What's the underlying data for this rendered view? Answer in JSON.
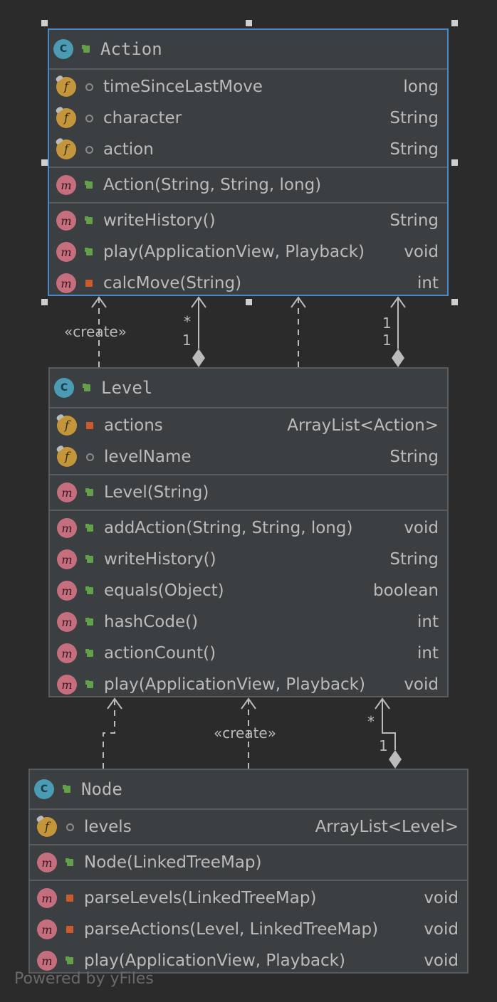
{
  "classes": {
    "action": {
      "name": "Action",
      "fields": [
        {
          "badge": "f",
          "vis": "package",
          "name": "timeSinceLastMove",
          "type": "long"
        },
        {
          "badge": "f",
          "vis": "package",
          "name": "character",
          "type": "String"
        },
        {
          "badge": "f",
          "vis": "package",
          "name": "action",
          "type": "String"
        }
      ],
      "constructors": [
        {
          "badge": "m",
          "vis": "public",
          "name": "Action(String, String, long)",
          "type": ""
        }
      ],
      "methods": [
        {
          "badge": "m",
          "vis": "public",
          "name": "writeHistory()",
          "type": "String"
        },
        {
          "badge": "m",
          "vis": "public",
          "name": "play(ApplicationView, Playback)",
          "type": "void"
        },
        {
          "badge": "m",
          "vis": "private",
          "name": "calcMove(String)",
          "type": "int"
        }
      ]
    },
    "level": {
      "name": "Level",
      "fields": [
        {
          "badge": "f",
          "vis": "private",
          "name": "actions",
          "type": "ArrayList<Action>"
        },
        {
          "badge": "f",
          "vis": "package",
          "name": "levelName",
          "type": "String"
        }
      ],
      "constructors": [
        {
          "badge": "m",
          "vis": "public",
          "name": "Level(String)",
          "type": ""
        }
      ],
      "methods": [
        {
          "badge": "m",
          "vis": "public",
          "name": "addAction(String, String, long)",
          "type": "void"
        },
        {
          "badge": "m",
          "vis": "public",
          "name": "writeHistory()",
          "type": "String"
        },
        {
          "badge": "m",
          "vis": "public",
          "name": "equals(Object)",
          "type": "boolean"
        },
        {
          "badge": "m",
          "vis": "public",
          "name": "hashCode()",
          "type": "int"
        },
        {
          "badge": "m",
          "vis": "public",
          "name": "actionCount()",
          "type": "int"
        },
        {
          "badge": "m",
          "vis": "public",
          "name": "play(ApplicationView, Playback)",
          "type": "void"
        }
      ]
    },
    "node": {
      "name": "Node",
      "fields": [
        {
          "badge": "f",
          "vis": "package",
          "name": "levels",
          "type": "ArrayList<Level>"
        }
      ],
      "constructors": [
        {
          "badge": "m",
          "vis": "public",
          "name": "Node(LinkedTreeMap)",
          "type": ""
        }
      ],
      "methods": [
        {
          "badge": "m",
          "vis": "private",
          "name": "parseLevels(LinkedTreeMap)",
          "type": "void"
        },
        {
          "badge": "m",
          "vis": "private",
          "name": "parseActions(Level, LinkedTreeMap)",
          "type": "void"
        },
        {
          "badge": "m",
          "vis": "public",
          "name": "play(ApplicationView, Playback)",
          "type": "void"
        }
      ]
    }
  },
  "badge_text": {
    "class": "C",
    "field": "f",
    "method": "m"
  },
  "relations": {
    "level_action_create": "«create»",
    "level_action_comp1_target": "*",
    "level_action_comp1_source": "1",
    "level_action_comp2_target": "1",
    "level_action_comp2_source": "1",
    "node_level_create": "«create»",
    "node_level_comp_target": "*",
    "node_level_comp_source": "1"
  },
  "footer": "Powered by yFiles",
  "colors": {
    "background": "#2b2b2b",
    "node_fill": "#3c3f41",
    "selection": "#4a88c7",
    "edge": "#bbbbbb"
  }
}
